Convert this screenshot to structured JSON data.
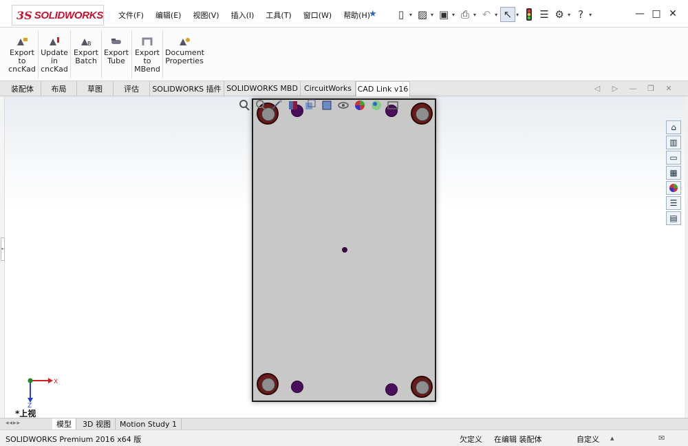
{
  "app": {
    "logo_ds": "3S",
    "logo_brand": "SOLIDWORKS"
  },
  "menu": [
    "文件(F)",
    "编辑(E)",
    "视图(V)",
    "插入(I)",
    "工具(T)",
    "窗口(W)",
    "帮助(H)"
  ],
  "toolbar_icons": [
    "new-file-icon",
    "open-icon",
    "save-icon",
    "print-icon",
    "undo-icon",
    "select-icon",
    "rebuild-icon",
    "file-properties-icon",
    "options-icon",
    "help-icon"
  ],
  "ribbon": {
    "buttons": [
      {
        "label": "Export\nto\ncncKad"
      },
      {
        "label": "Update\nin\ncncKad"
      },
      {
        "label": "Export\nBatch"
      },
      {
        "label": "Export\nTube"
      },
      {
        "label": "Export\nto\nMBend"
      },
      {
        "label": "Document\nProperties"
      }
    ]
  },
  "tabs": [
    "装配体",
    "布局",
    "草图",
    "评估",
    "SOLIDWORKS 插件",
    "SOLIDWORKS MBD",
    "CircuitWorks",
    "CAD Link v16"
  ],
  "graphics": {
    "view_name": "*上视",
    "triad_x": "X",
    "triad_z": "Z"
  },
  "bottom_tabs": [
    "模型",
    "3D 视图",
    "Motion Study 1"
  ],
  "status": {
    "product": "SOLIDWORKS Premium 2016 x64 版",
    "underdefined": "欠定义",
    "editing": "在编辑 装配体",
    "units": "自定义"
  },
  "colors": {
    "brand_red": "#c8102e",
    "counterbore": "#6b1a1a",
    "pin_hole": "#4a0f5a",
    "part_gray": "#c8c8c8"
  }
}
